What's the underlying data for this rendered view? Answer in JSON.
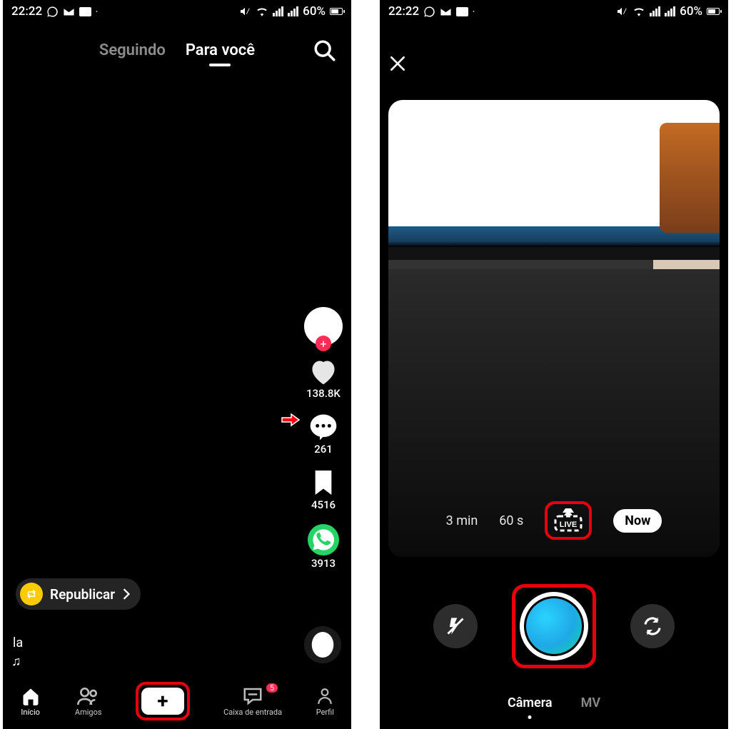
{
  "statusbar": {
    "time": "22:22",
    "battery": "60%"
  },
  "left": {
    "tabs": {
      "following": "Seguindo",
      "for_you": "Para você"
    },
    "stats": {
      "likes": "138.8K",
      "comments": "261",
      "saves": "4516",
      "shares": "3913"
    },
    "repost": {
      "label": "Republicar"
    },
    "caption": "la",
    "nav": {
      "home": "Início",
      "friends": "Amigos",
      "inbox": "Caixa de entrada",
      "inbox_badge": "5",
      "profile": "Perfil"
    }
  },
  "right": {
    "durations": {
      "three_min": "3 min",
      "sixty_s": "60 s",
      "live": "LIVE",
      "now": "Now"
    },
    "modes": {
      "camera": "Câmera",
      "mv": "MV"
    }
  }
}
